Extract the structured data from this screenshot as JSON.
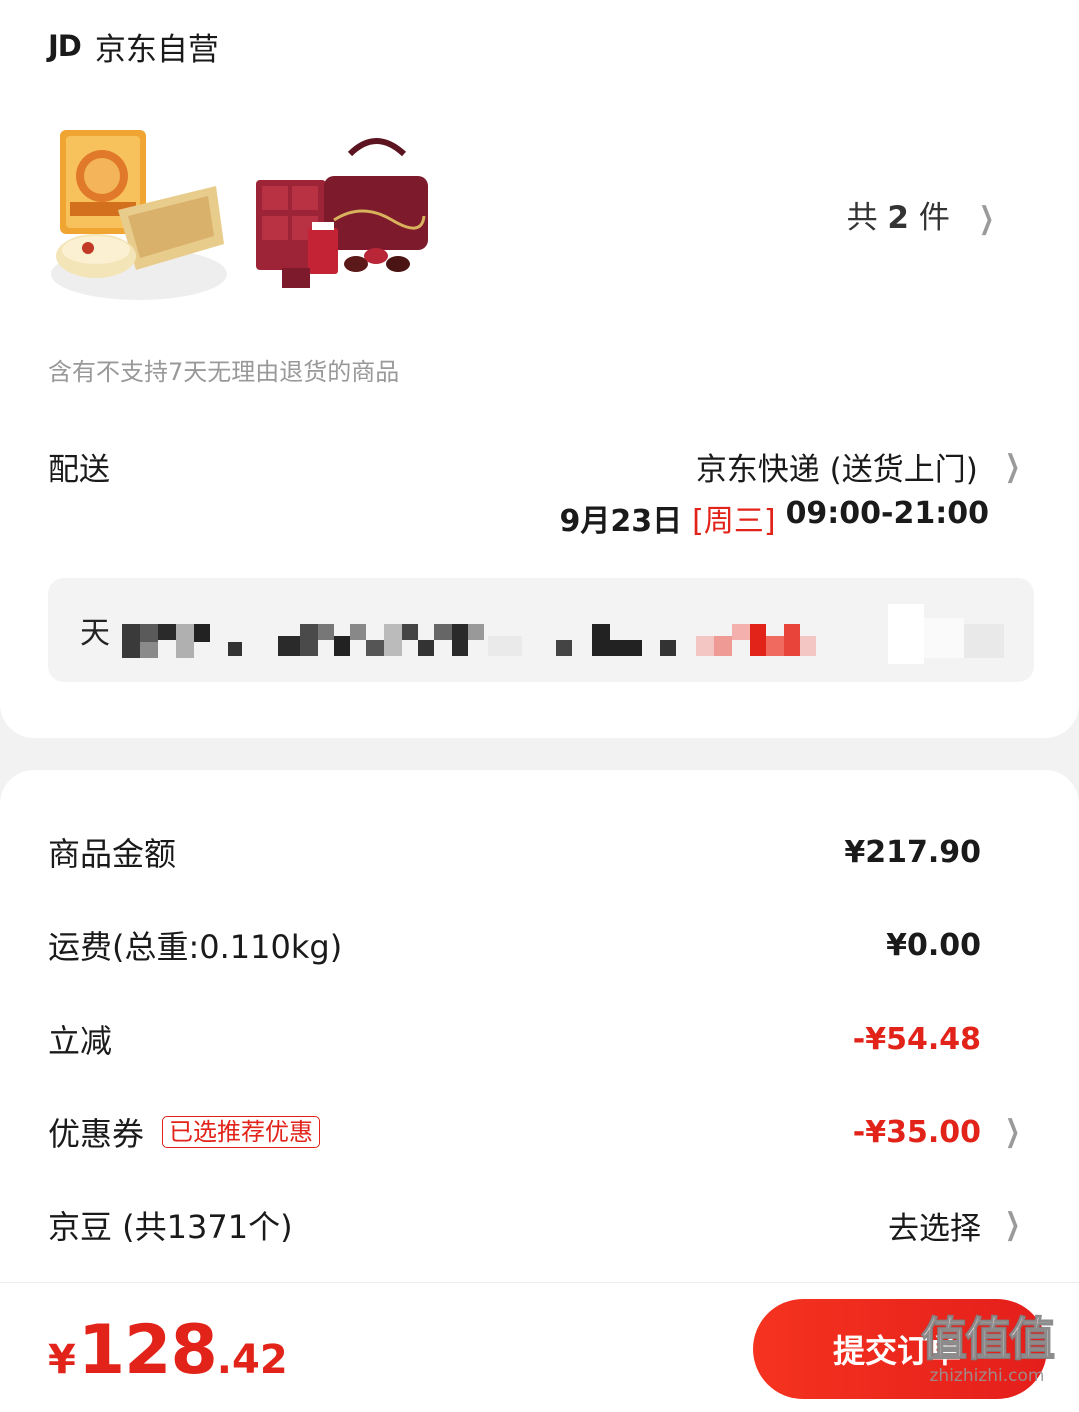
{
  "store": {
    "logo_text": "JD",
    "name": "京东自营"
  },
  "products": {
    "items": [
      {
        "name": "mooncake-product"
      },
      {
        "name": "costa-gift-box-product"
      }
    ],
    "count_prefix": "共",
    "count_num": "2",
    "count_suffix": "件",
    "no_return_notice": "含有不支持7天无理由退货的商品"
  },
  "shipping": {
    "label": "配送",
    "method": "京东快递 (送货上门)",
    "date": "9月23日",
    "weekday": "[周三]",
    "time_range": "09:00-21:00"
  },
  "address": {
    "first_char": "天"
  },
  "summary": {
    "rows": [
      {
        "label": "商品金额",
        "value": "¥217.90"
      },
      {
        "label": "运费(总重:0.110kg)",
        "value": "¥0.00"
      },
      {
        "label": "立减",
        "value": "-¥54.48"
      },
      {
        "label": "优惠券",
        "tag": "已选推荐优惠",
        "value": "-¥35.00"
      },
      {
        "label": "京豆 (共1371个)",
        "value": "去选择"
      }
    ]
  },
  "bottom": {
    "currency": "¥",
    "total_int": "128",
    "total_dec": ".42",
    "submit_label": "提交订单"
  },
  "watermark": {
    "mark": "值值值",
    "url": "zhizhizhi.com"
  },
  "colors": {
    "accent_red": "#e2231a",
    "background": "#f2f2f2",
    "card": "#ffffff"
  }
}
